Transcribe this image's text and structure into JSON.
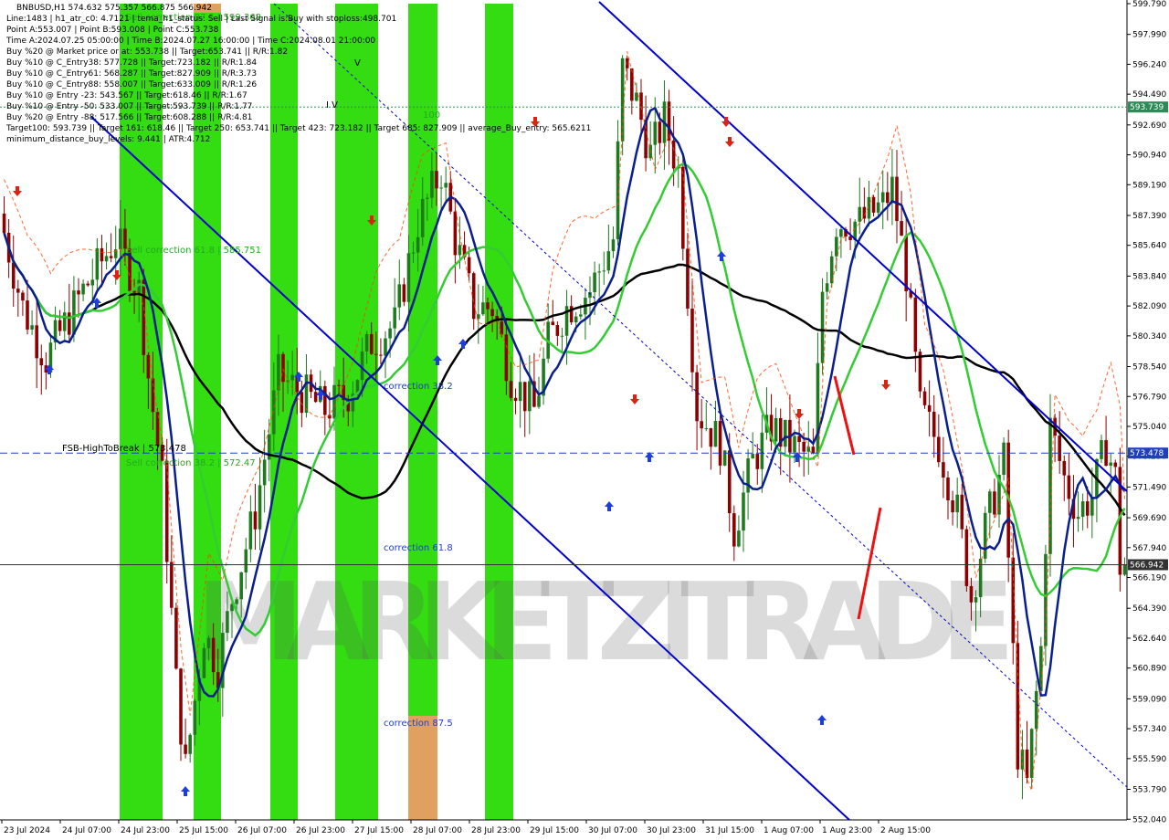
{
  "header": {
    "symbol_line": "BNBUSD,H1  574.632 575.357 566.875 566.942",
    "lines": [
      "Line:1483 | h1_atr_c0: 4.7121 | tema_h1_status: Sell | Last Signal is:Buy with stoploss:498.701",
      "Point A:553.007 | Point B:593.008 | Point C:553.738",
      "Time A:2024.07.25 05:00:00 | Time B:2024.07.27 16:00:00 | Time C:2024.08.01 21:00:00",
      "Buy %20 @ Market price or at: 553.738 || Target:653.741 || R/R:1.82",
      "Buy %10 @ C_Entry38: 577.728 || Target:723.182 || R/R:1.84",
      "Buy %10 @ C_Entry61: 568.287 || Target:827.909 || R/R:3.73",
      "Buy %10 @ C_Entry88: 558.007 || Target:633.009 || R/R:1.26",
      "Buy %10 @ Entry -23: 543.567 || Target:618.46 || R/R:1.67",
      "Buy %10 @ Entry -50: 533.007 || Target:593.739 || R/R:1.77",
      "Buy %20 @ Entry -88: 517.566 || Target:608.288 || R/R:4.81",
      "Target100: 593.739 || Target 161: 618.46 || Target 250: 653.741 || Target 423: 723.182 || Target 685: 827.909 || average_Buy_entry: 565.6211",
      "minimum_distance_buy_levels: 9.441 | ATR:4.712"
    ]
  },
  "chart_data": {
    "type": "candlestick",
    "symbol": "BNBUSD",
    "timeframe": "H1",
    "ylim": [
      552.0,
      599.79
    ],
    "y_ticks": [
      "599.790",
      "597.990",
      "596.240",
      "594.490",
      "592.690",
      "590.940",
      "589.190",
      "587.390",
      "585.640",
      "583.840",
      "582.090",
      "580.340",
      "578.540",
      "576.790",
      "575.040",
      "573.290",
      "571.490",
      "569.690",
      "567.940",
      "566.190",
      "564.390",
      "562.640",
      "560.890",
      "559.090",
      "557.340",
      "555.590",
      "553.790",
      "552.040"
    ],
    "x_labels": [
      "23 Jul 2024",
      "24 Jul 07:00",
      "24 Jul 23:00",
      "25 Jul 15:00",
      "26 Jul 07:00",
      "26 Jul 23:00",
      "27 Jul 15:00",
      "28 Jul 07:00",
      "28 Jul 23:00",
      "29 Jul 15:00",
      "30 Jul 07:00",
      "30 Jul 23:00",
      "31 Jul 15:00",
      "1 Aug 07:00",
      "1 Aug 23:00",
      "2 Aug 15:00"
    ],
    "bars_count": 242,
    "price_markers": [
      {
        "value": 593.739,
        "label": "593.739",
        "color": "#2e8b57",
        "style": "dotted"
      },
      {
        "value": 573.478,
        "label": "573.478",
        "color": "#1f3fbf",
        "style": "dashed"
      },
      {
        "value": 566.942,
        "label": "566.942",
        "color": "#333333",
        "style": "solid"
      }
    ],
    "annotations": [
      {
        "text": "Sell correction 87.5 | 599.368",
        "color": "#22aa22"
      },
      {
        "text": "Sell correction 61.8 | 585.751",
        "color": "#22aa22"
      },
      {
        "text": "Sell correction 38.2 | 572.47",
        "color": "#22aa22"
      },
      {
        "text": "FSB-HighToBreak | 573.478",
        "color": "#000000"
      },
      {
        "text": "correction 38.2",
        "color": "#1f3fbf"
      },
      {
        "text": "correction 61.8",
        "color": "#1f3fbf"
      },
      {
        "text": "correction 87.5",
        "color": "#1f3fbf"
      },
      {
        "text": "100",
        "color": "#22aa22"
      },
      {
        "text": "I V",
        "color": "#000000"
      },
      {
        "text": "V",
        "color": "#000000"
      }
    ],
    "watermark": "MARKETZITRADE",
    "colors": {
      "bull": "#1f7a1f",
      "bear": "#8b0000",
      "ma_black": "#000000",
      "ma_green": "#33cc33",
      "ma_navy": "#0a1f8f",
      "channel": "#0000cc",
      "bands": "#33dd11",
      "band_orange": "#e0a060",
      "stop_line": "#ff4400"
    }
  }
}
